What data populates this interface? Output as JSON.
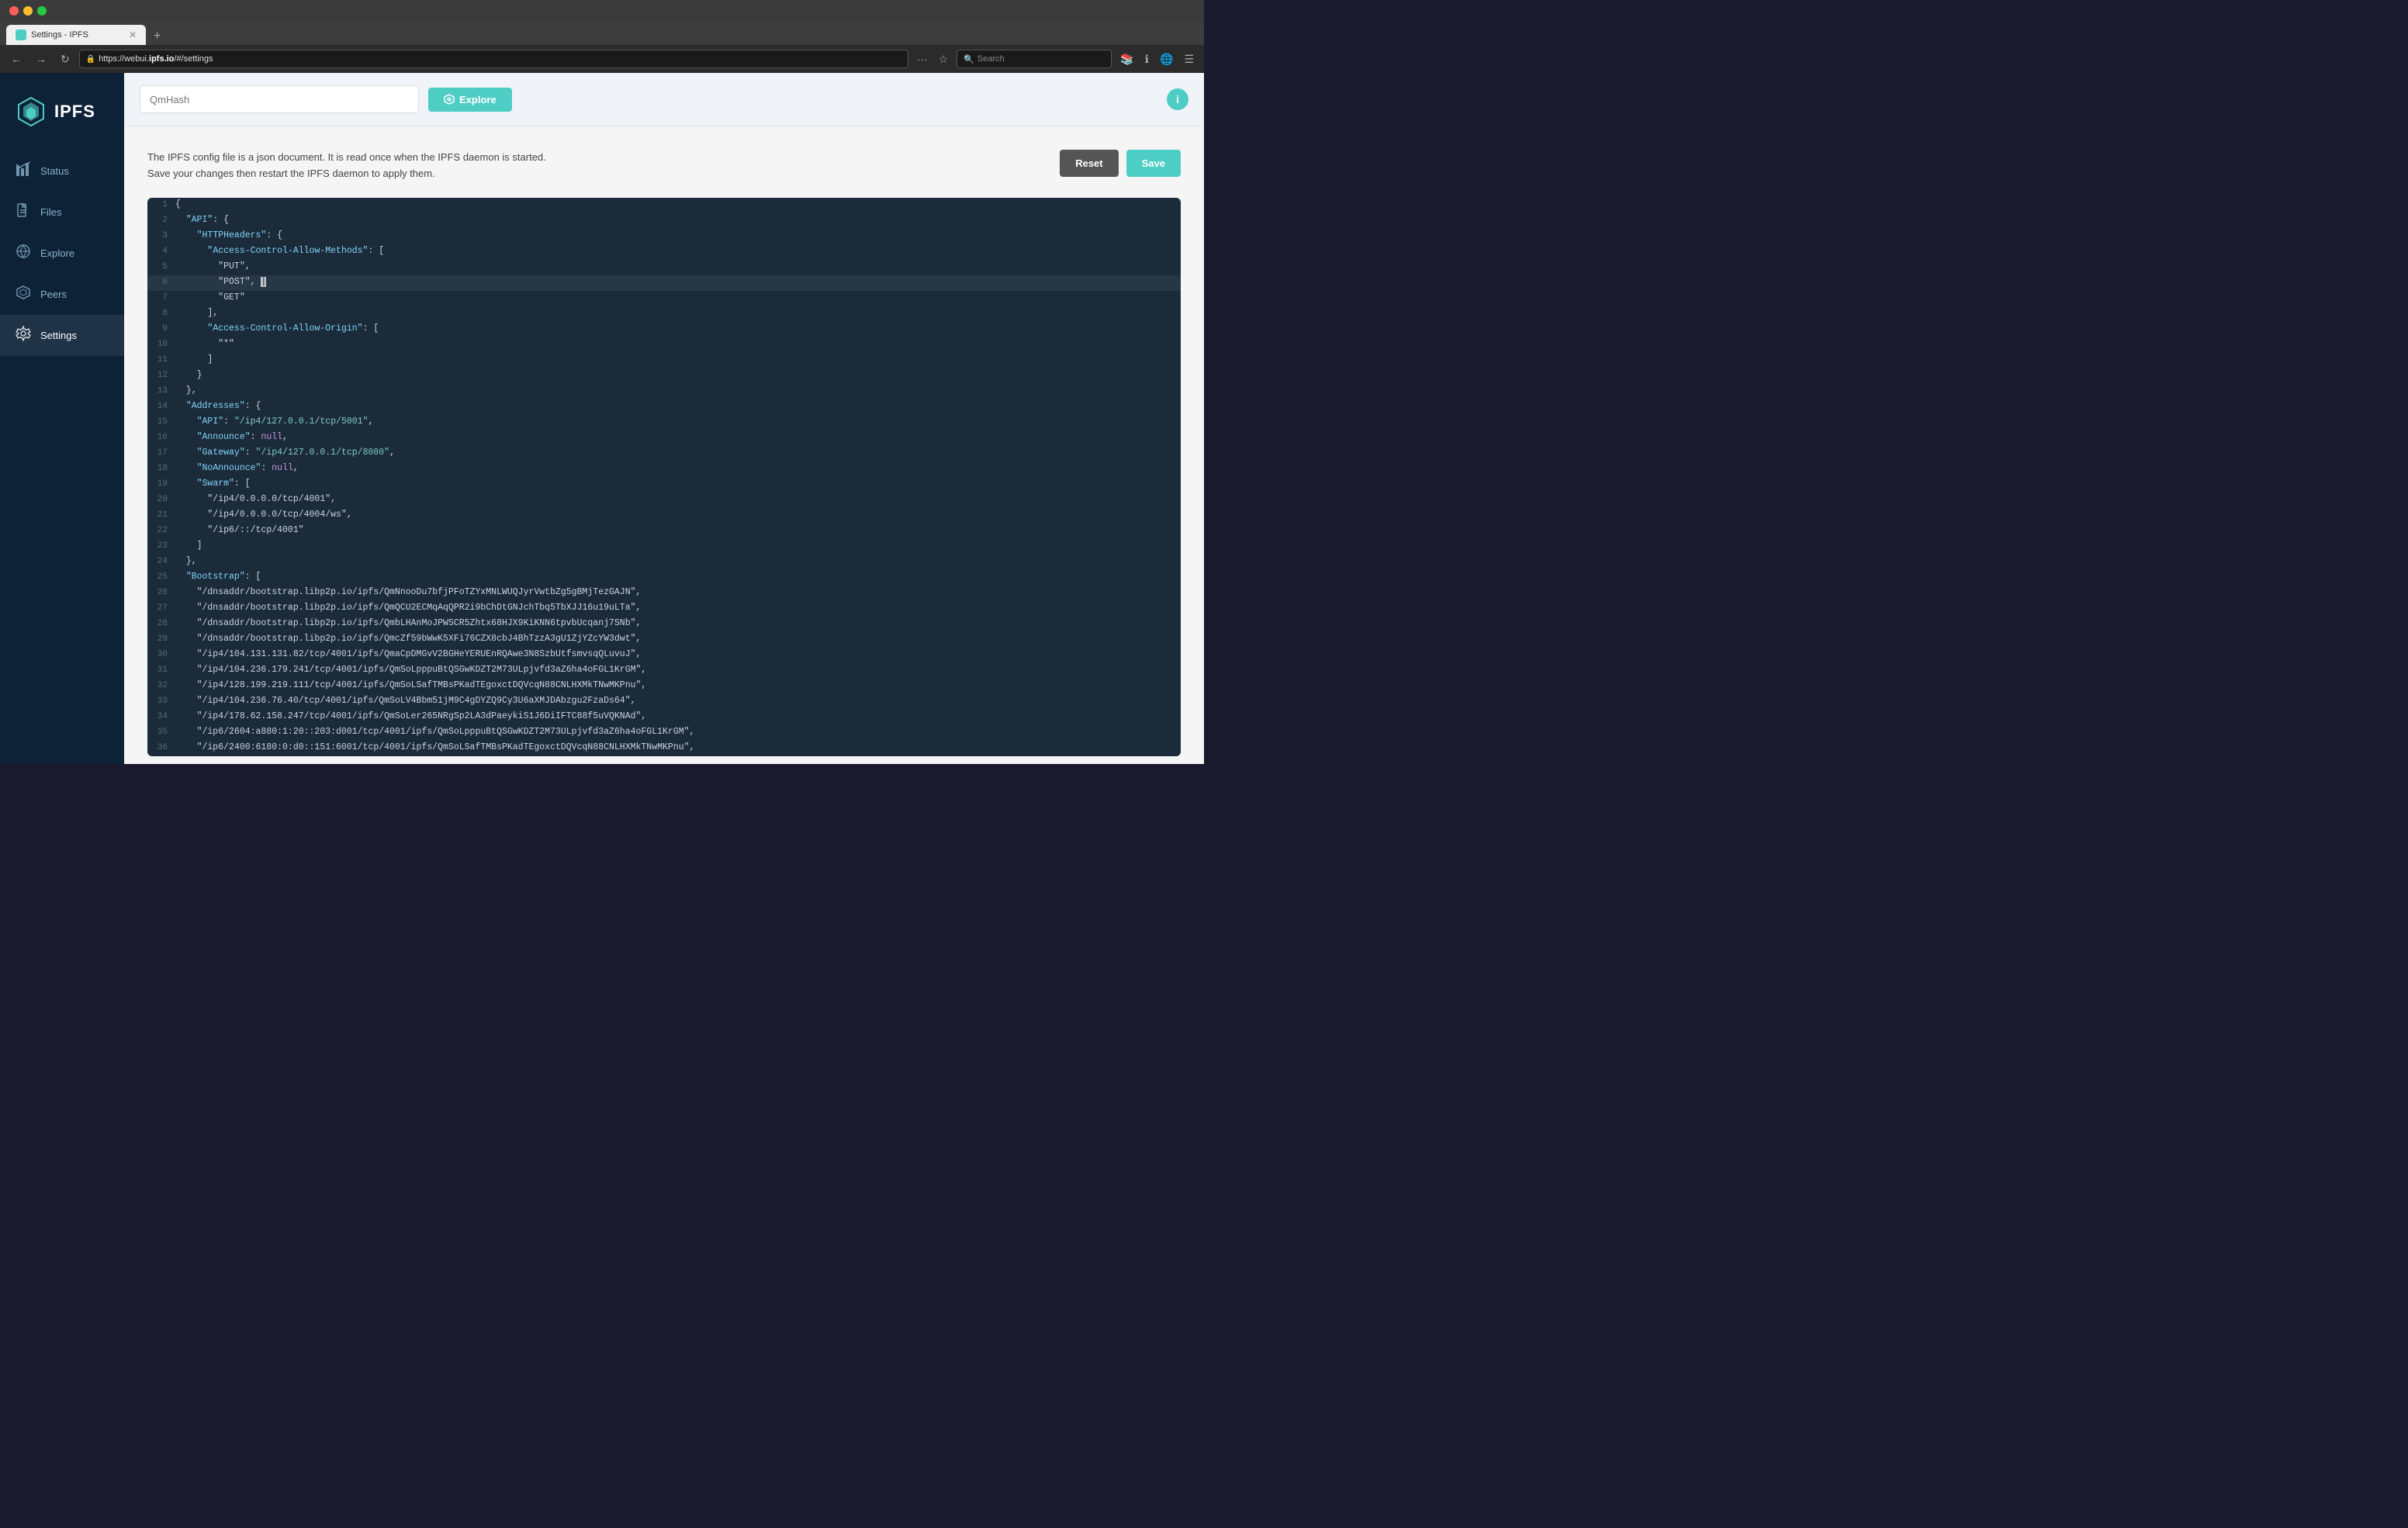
{
  "titlebar": {
    "dots": [
      "red",
      "yellow",
      "green"
    ]
  },
  "browser": {
    "url": "https://webui.ipfs.io/#/settings",
    "url_domain": "ipfs.io",
    "tab_title": "Settings - IPFS",
    "search_placeholder": "Search"
  },
  "sidebar": {
    "logo": "IPFS",
    "nav_items": [
      {
        "id": "status",
        "label": "Status",
        "icon": "📊"
      },
      {
        "id": "files",
        "label": "Files",
        "icon": "📄"
      },
      {
        "id": "explore",
        "label": "Explore",
        "icon": "🌿"
      },
      {
        "id": "peers",
        "label": "Peers",
        "icon": "⬡"
      },
      {
        "id": "settings",
        "label": "Settings",
        "icon": "⚙️",
        "active": true
      }
    ]
  },
  "explore_bar": {
    "placeholder": "QmHash",
    "button_label": "Explore"
  },
  "settings": {
    "description_line1": "The IPFS config file is a json document. It is read once when the IPFS daemon is started.",
    "description_line2": "Save your changes then restart the IPFS daemon to apply them.",
    "reset_label": "Reset",
    "save_label": "Save"
  },
  "code": {
    "lines": [
      {
        "num": 1,
        "content": "{",
        "highlight": false
      },
      {
        "num": 2,
        "content": "  \"API\": {",
        "highlight": false
      },
      {
        "num": 3,
        "content": "    \"HTTPHeaders\": {",
        "highlight": false
      },
      {
        "num": 4,
        "content": "      \"Access-Control-Allow-Methods\": [",
        "highlight": false
      },
      {
        "num": 5,
        "content": "        \"PUT\",",
        "highlight": false
      },
      {
        "num": 6,
        "content": "        \"POST\", |",
        "highlight": true
      },
      {
        "num": 7,
        "content": "        \"GET\"",
        "highlight": false
      },
      {
        "num": 8,
        "content": "      ],",
        "highlight": false
      },
      {
        "num": 9,
        "content": "      \"Access-Control-Allow-Origin\": [",
        "highlight": false
      },
      {
        "num": 10,
        "content": "        \"*\"",
        "highlight": false
      },
      {
        "num": 11,
        "content": "      ]",
        "highlight": false
      },
      {
        "num": 12,
        "content": "    }",
        "highlight": false
      },
      {
        "num": 13,
        "content": "  },",
        "highlight": false
      },
      {
        "num": 14,
        "content": "  \"Addresses\": {",
        "highlight": false
      },
      {
        "num": 15,
        "content": "    \"API\": \"/ip4/127.0.0.1/tcp/5001\",",
        "highlight": false
      },
      {
        "num": 16,
        "content": "    \"Announce\": null,",
        "highlight": false
      },
      {
        "num": 17,
        "content": "    \"Gateway\": \"/ip4/127.0.0.1/tcp/8080\",",
        "highlight": false
      },
      {
        "num": 18,
        "content": "    \"NoAnnounce\": null,",
        "highlight": false
      },
      {
        "num": 19,
        "content": "    \"Swarm\": [",
        "highlight": false
      },
      {
        "num": 20,
        "content": "      \"/ip4/0.0.0.0/tcp/4001\",",
        "highlight": false
      },
      {
        "num": 21,
        "content": "      \"/ip4/0.0.0.0/tcp/4004/ws\",",
        "highlight": false
      },
      {
        "num": 22,
        "content": "      \"/ip6/::/tcp/4001\"",
        "highlight": false
      },
      {
        "num": 23,
        "content": "    ]",
        "highlight": false
      },
      {
        "num": 24,
        "content": "  },",
        "highlight": false
      },
      {
        "num": 25,
        "content": "  \"Bootstrap\": [",
        "highlight": false
      },
      {
        "num": 26,
        "content": "    \"/dnsaddr/bootstrap.libp2p.io/ipfs/QmNnooDu7bfjPFoTZYxMNLWUQJyrVwtbZg5gBMjTezGAJN\",",
        "highlight": false
      },
      {
        "num": 27,
        "content": "    \"/dnsaddr/bootstrap.libp2p.io/ipfs/QmQCU2ECMqAqQPR2i9bChDtGNJchTbq5TbXJJ16u19uLTa\",",
        "highlight": false
      },
      {
        "num": 28,
        "content": "    \"/dnsaddr/bootstrap.libp2p.io/ipfs/QmbLHAnMoJPWSCR5Zhtx68HJX9KiKNN6tpvbUcqanj7SNb\",",
        "highlight": false
      },
      {
        "num": 29,
        "content": "    \"/dnsaddr/bootstrap.libp2p.io/ipfs/QmcZf59bWwK5XFi76CZX8cbJ4BhTzzA3gU1ZjYZcYW3dwt\",",
        "highlight": false
      },
      {
        "num": 30,
        "content": "    \"/ip4/104.131.131.82/tcp/4001/ipfs/QmaCpDMGvV2BGHeYERUEnRQAwe3N8SzbUtfsmvsqQLuvuJ\",",
        "highlight": false
      },
      {
        "num": 31,
        "content": "    \"/ip4/104.236.179.241/tcp/4001/ipfs/QmSoLpppuBtQSGwKDZT2M73ULpjvfd3aZ6ha4oFGL1KrGM\",",
        "highlight": false
      },
      {
        "num": 32,
        "content": "    \"/ip4/128.199.219.111/tcp/4001/ipfs/QmSoLSafTMBsPKadTEgoxctDQVcqN88CNLHXMkTNwMKPnu\",",
        "highlight": false
      },
      {
        "num": 33,
        "content": "    \"/ip4/104.236.76.40/tcp/4001/ipfs/QmSoLV4Bbm51jM9C4gDYZQ9Cy3U6aXMJDAbzgu2FzaDs64\",",
        "highlight": false
      },
      {
        "num": 34,
        "content": "    \"/ip4/178.62.158.247/tcp/4001/ipfs/QmSoLer265NRgSp2LA3dPaeykiS1J6DiIFTC88f5uVQKNAd\",",
        "highlight": false
      },
      {
        "num": 35,
        "content": "    \"/ip6/2604:a880:1:20::203:d001/tcp/4001/ipfs/QmSoLpppuBtQSGwKDZT2M73ULpjvfd3aZ6ha4oFGL1KrGM\",",
        "highlight": false
      },
      {
        "num": 36,
        "content": "    \"/ip6/2400:6180:0:d0::151:6001/tcp/4001/ipfs/QmSoLSafTMBsPKadTEgoxctDQVcqN88CNLHXMkTNwMKPnu\",",
        "highlight": false
      }
    ]
  }
}
